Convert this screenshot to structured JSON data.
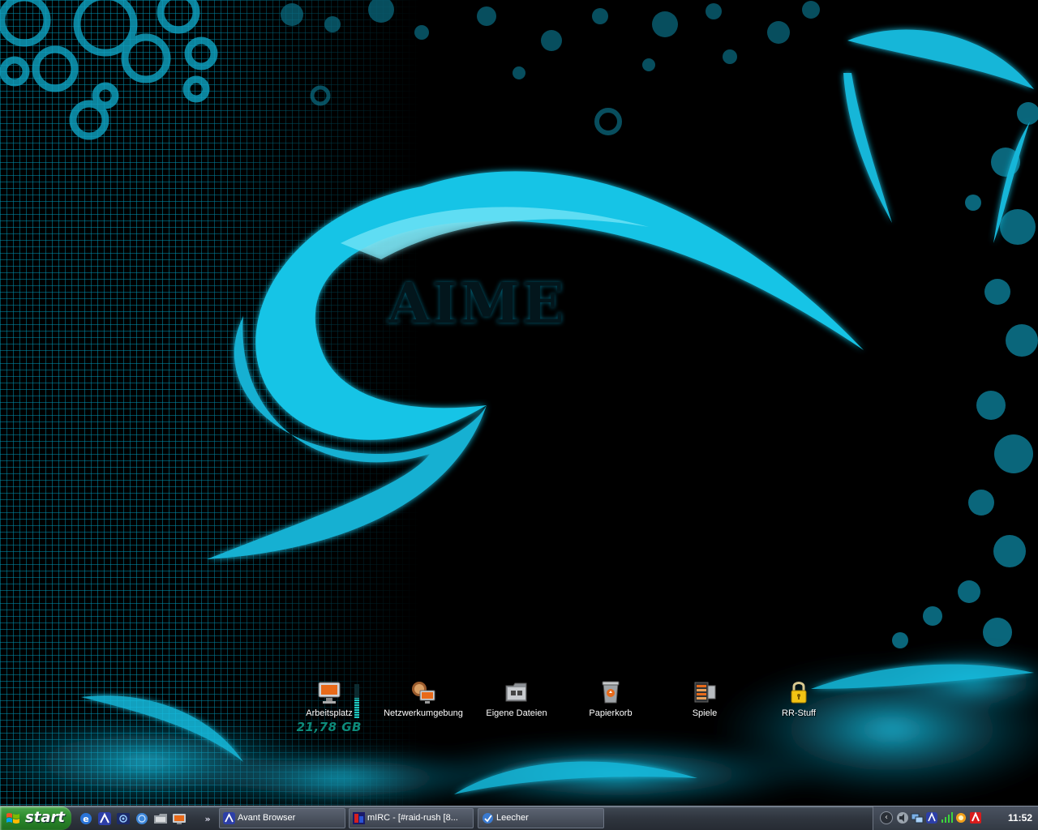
{
  "desktop": {
    "icons": [
      {
        "label": "Arbeitsplatz",
        "icon": "computer-icon"
      },
      {
        "label": "Netzwerkumgebung",
        "icon": "network-icon"
      },
      {
        "label": "Eigene Dateien",
        "icon": "folder-icon"
      },
      {
        "label": "Papierkorb",
        "icon": "recycle-bin-icon"
      },
      {
        "label": "Spiele",
        "icon": "games-icon"
      },
      {
        "label": "RR-Stuff",
        "icon": "lock-icon"
      }
    ],
    "drive_widget": {
      "free_space": "21,78 GB",
      "meter_level_percent": 60
    }
  },
  "wallpaper": {
    "logo_text": "AIME",
    "accent_color": "#18c8e8"
  },
  "taskbar": {
    "start_label": "start",
    "quicklaunch": [
      "ie-icon",
      "avant-browser-icon",
      "radio-icon",
      "globe-icon",
      "explorer-icon",
      "media-icon"
    ],
    "quicklaunch_more": "»",
    "tasks": [
      {
        "label": "Avant Browser",
        "icon": "avant-browser-icon"
      },
      {
        "label": "mIRC - [#raid-rush [8...",
        "icon": "mirc-icon"
      },
      {
        "label": "Leecher",
        "icon": "leecher-icon"
      }
    ],
    "tray": {
      "chevron": "‹",
      "icons": [
        "volume-icon",
        "network-tray-icon",
        "avant-tray-icon",
        "wifi-icon",
        "messenger-icon",
        "antivirus-icon"
      ],
      "clock": "11:52"
    }
  }
}
